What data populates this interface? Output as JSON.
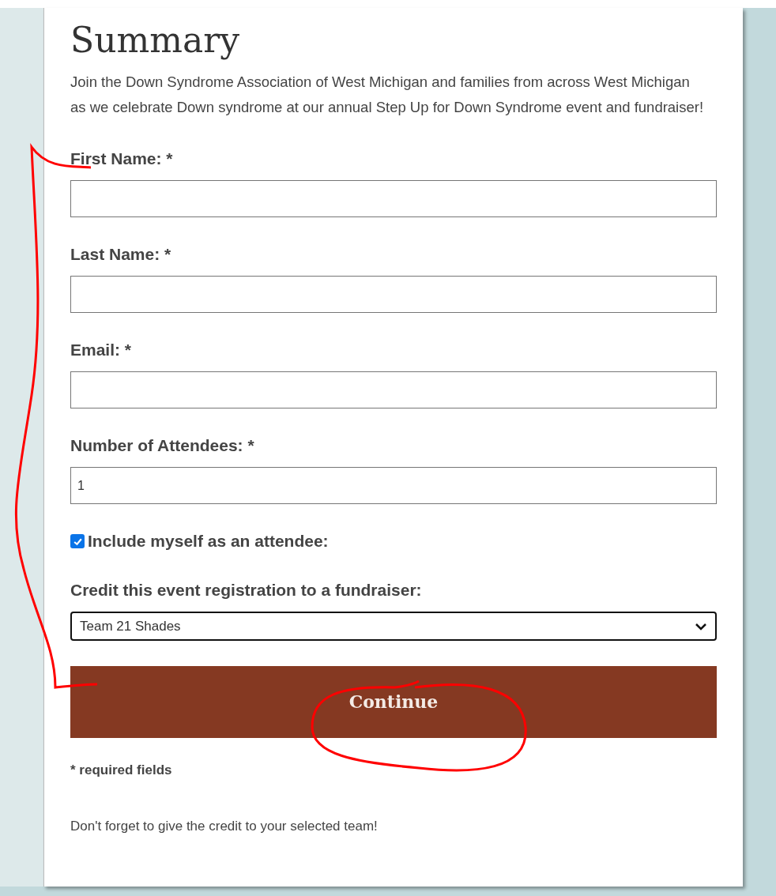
{
  "title": "Summary",
  "intro": "Join the Down Syndrome Association of West Michigan and families from across West Michigan as we celebrate Down syndrome at our annual Step Up for Down Syndrome event and fundraiser!",
  "fields": [
    {
      "kind": "text",
      "label": "First Name: *"
    },
    {
      "kind": "text",
      "label": "Last Name: *"
    },
    {
      "kind": "text",
      "label": "Email: *"
    },
    {
      "kind": "text",
      "label": "Number of Attendees: *",
      "value": "1"
    },
    {
      "kind": "checkbox",
      "label": "Include myself as an attendee:",
      "checked": true
    },
    {
      "kind": "select",
      "label": "Credit this event registration to a fundraiser:",
      "value": "Team 21 Shades"
    }
  ],
  "submit": "Continue",
  "required_note": "* required fields",
  "footer_note": "Don't forget to give the credit to your selected team!"
}
